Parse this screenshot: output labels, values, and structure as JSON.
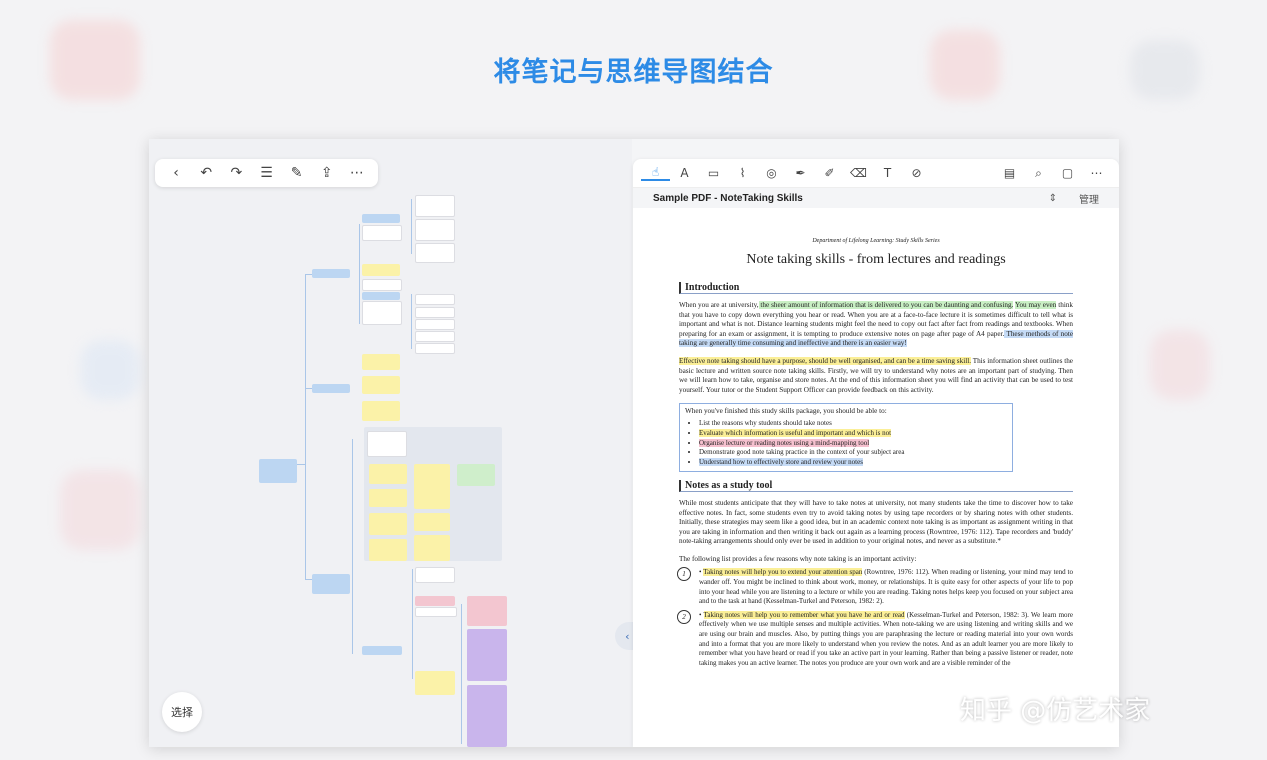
{
  "headline": "将笔记与思维导图结合",
  "mindmap": {
    "toolbar_icons": [
      "back-icon",
      "undo-icon",
      "redo-icon",
      "outline-list-icon",
      "edit-icon",
      "share-icon",
      "more-icon"
    ],
    "toolbar_glyphs": [
      "‹",
      "↶",
      "↷",
      "☰",
      "✎",
      "⇪",
      "⋯"
    ],
    "select_label": "选择"
  },
  "pdf": {
    "toolbar_icons": [
      "hand-icon",
      "text-highlight-icon",
      "rectangle-select-icon",
      "shape-icon",
      "lasso-icon",
      "pen-icon",
      "marker-icon",
      "eraser-icon",
      "textbox-icon",
      "clear-icon",
      "document-icon",
      "search-icon",
      "bookmark-icon",
      "more-icon"
    ],
    "toolbar_glyphs": [
      "☝",
      "A",
      "▭",
      "⌇",
      "◎",
      "✒",
      "✐",
      "⌫",
      "T",
      "⊘",
      "▤",
      "⌕",
      "▢",
      "⋯"
    ],
    "tab_title": "Sample PDF - NoteTaking Skills",
    "manage_label": "管理",
    "dept": "Department of Lifelong Learning: Study Skills Series",
    "doc_title": "Note taking skills - from lectures and readings",
    "section1": "Introduction",
    "p1_a": "When you are at university,",
    "p1_hl1": " the sheer amount of information that is delivered to you can be daunting and confusing.",
    "p1_hl2": "You may even",
    "p1_b": " think that you have to copy down everything you hear or read. When you are at a face-to-face lecture it is sometimes difficult to tell what is important and what is not. Distance learning students might feel the need to copy out fact after fact from readings and textbooks. When preparing for an exam or assignment, it is tempting to produce extensive notes on page after page of A4 paper.",
    "p1_hl3": " These methods of note taking are generally time consuming and ineffective and there is an easier way!",
    "p2_hl": "Effective note taking should have a purpose, should be well organised, and can be a time saving skill.",
    "p2_b": " This information sheet outlines the basic lecture and written source note taking skills. Firstly, we will try to understand why notes are an important part of studying. Then we will learn how to take, organise and store notes. At the end of this information sheet you will find an activity that can be used to test yourself. Your tutor or the Student Support Officer can provide feedback on this activity.",
    "box_intro": "When you've finished this study skills package, you should be able to:",
    "box_items": [
      "List the reasons why students should take notes",
      "Evaluate which information is useful and important and which is not",
      "Organise lecture or reading notes using a mind-mapping tool",
      "Demonstrate good note taking practice in the context of your subject area",
      "Understand how to effectively store and review your notes"
    ],
    "section2": "Notes as a study tool",
    "p3": "While most students anticipate that they will have to take notes at university, not many students take the time to discover how to take effective notes. In fact, some students even try to avoid taking notes by using tape recorders or by sharing notes with other students. Initially, these strategies may seem like a good idea, but in an academic context note taking is as important as assignment writing in that you are taking in information and then writing it back out again as a learning process (Rowntree, 1976: 112). Tape recorders and 'buddy' note-taking arrangements should only ever be used in addition to your original notes, and never as a substitute.*",
    "p4": "The following list provides a few reasons why note taking is an important activity:",
    "item1_num": "1",
    "item1_hl": "Taking notes will help you to extend your attention span",
    "item1_b": " (Rowntree, 1976: 112). When reading or listening, your mind may tend to wander off. You might be inclined to think about work, money, or relationships. It is quite easy for other aspects of your life to pop into your head while you are listening to a lecture or while you are reading. Taking notes helps keep you focused on your subject area and to the task at hand (Kesselman-Turkel and Peterson, 1982: 2).",
    "item2_num": "2",
    "item2_hl": "Taking notes will help you to remember what you have he ard or read",
    "item2_b": " (Kesselman-Turkel and Peterson, 1982: 3). We learn more effectively when we use multiple senses and multiple activities. When note-taking we are using listening and writing skills and we are using our brain and muscles. Also, by putting things you are paraphrasing the lecture or reading material into your own words and into a format that you are more likely to understand when you review the notes. And as an adult learner you are more likely to remember what you have heard or read if you take an active part in your learning. Rather than being a passive listener or reader, note taking makes you an active learner. The notes you produce are your own work and are a visible reminder of the"
  },
  "watermark": "知乎 @仿艺术家",
  "colors": {
    "accent": "#2d8be6",
    "node_blue": "#bcd6f2",
    "node_yellow": "#fbf2a8",
    "node_pink": "#f3c6d0",
    "node_purple": "#c9b5ec"
  }
}
